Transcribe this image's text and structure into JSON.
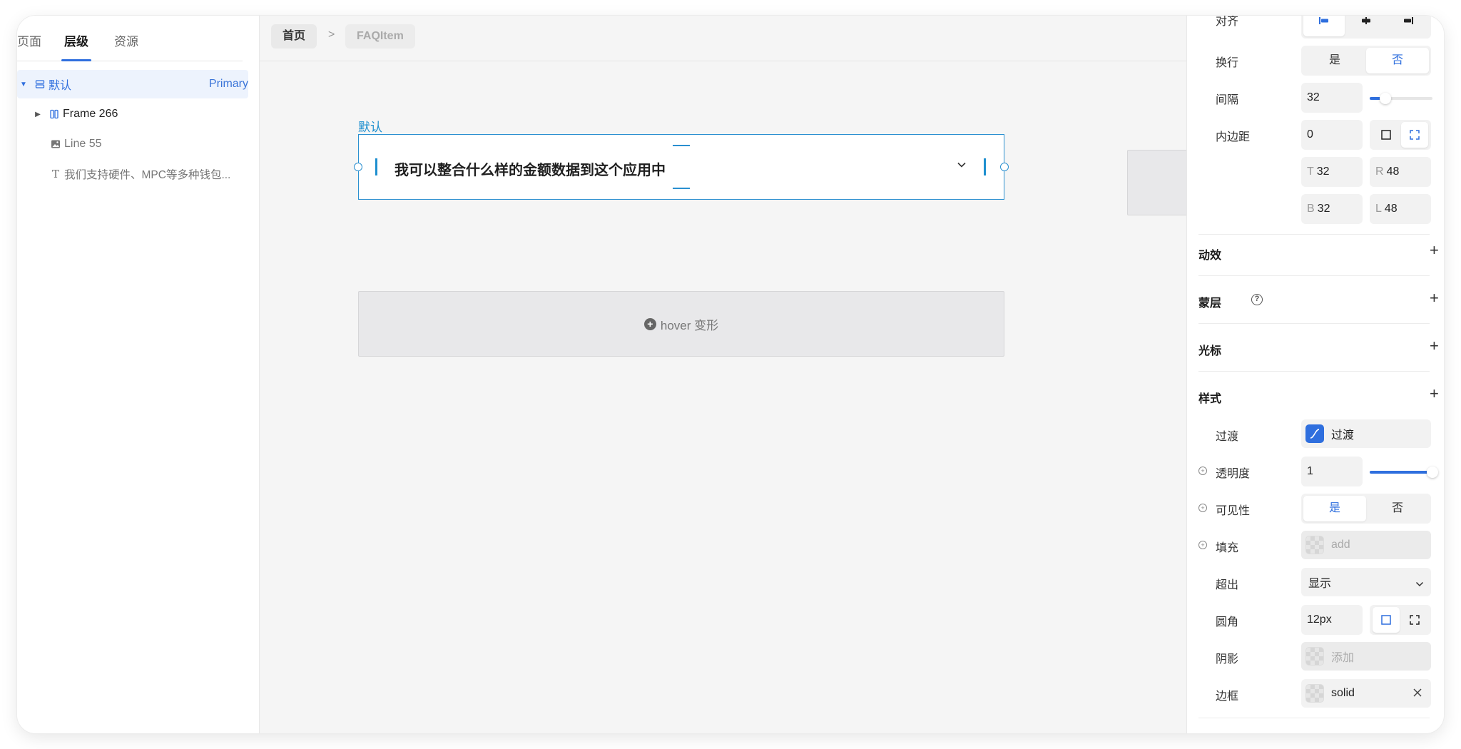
{
  "left": {
    "tabs": [
      "页面",
      "层级",
      "资源"
    ],
    "tree": [
      {
        "label": "默认",
        "badge": "Primary"
      },
      {
        "label": "Frame 266"
      },
      {
        "label": "Line 55"
      },
      {
        "label": "我们支持硬件、MPC等多种钱包..."
      }
    ]
  },
  "breadcrumb": {
    "home": "首页",
    "sep": ">",
    "current": "FAQItem"
  },
  "canvas": {
    "frame_label": "默认",
    "question": "我可以整合什么样的金额数据到这个应用中",
    "hover_label": "hover 变形"
  },
  "panel": {
    "align_label": "对齐",
    "wrap_label": "换行",
    "wrap_yes": "是",
    "wrap_no": "否",
    "gap_label": "间隔",
    "gap_value": "32",
    "gap_level": 0.25,
    "padding_label": "内边距",
    "padding_value": "0",
    "pad_t_prefix": "T",
    "pad_t": "32",
    "pad_r_prefix": "R",
    "pad_r": "48",
    "pad_b_prefix": "B",
    "pad_b": "32",
    "pad_l_prefix": "L",
    "pad_l": "48",
    "sec_motion": "动效",
    "sec_mask": "蒙层",
    "sec_cursor": "光标",
    "sec_style": "样式",
    "transition_label": "过渡",
    "transition_value": "过渡",
    "opacity_label": "透明度",
    "opacity_value": "1",
    "opacity_level": 1,
    "visibility_label": "可见性",
    "vis_yes": "是",
    "vis_no": "否",
    "fill_label": "填充",
    "fill_placeholder": "add",
    "overflow_label": "超出",
    "overflow_value": "显示",
    "radius_label": "圆角",
    "radius_value": "12px",
    "shadow_label": "阴影",
    "shadow_placeholder": "添加",
    "border_label": "边框",
    "border_value": "solid"
  },
  "colors": {
    "accent": "#2f6fde",
    "selection": "#2a8fd0"
  }
}
